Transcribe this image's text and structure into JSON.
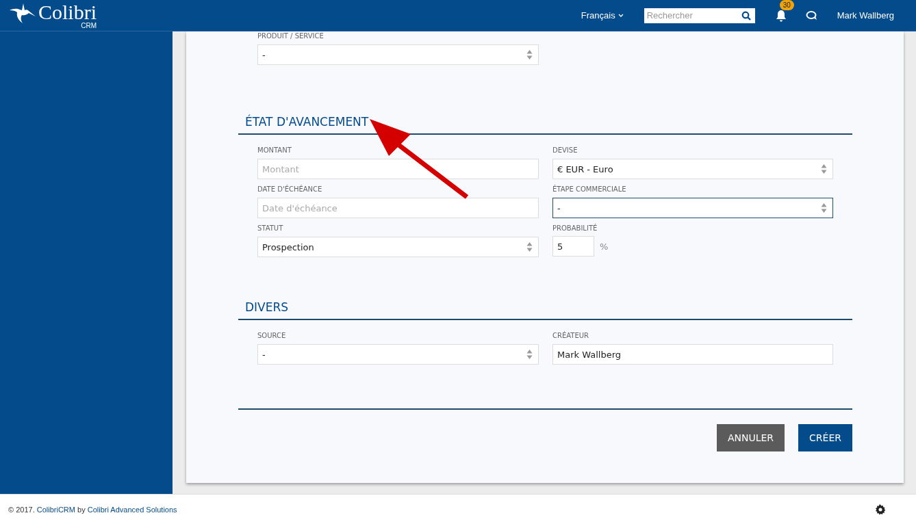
{
  "header": {
    "logo": {
      "name": "Colibri",
      "sub": "CRM"
    },
    "language": "Français",
    "search": {
      "placeholder": "Rechercher"
    },
    "notifications": {
      "count": "30"
    },
    "user": "Mark Wallberg"
  },
  "top_fields": [
    {
      "label": "PRODUIT / SERVICE",
      "kind": "select",
      "value": "-",
      "focused": false
    }
  ],
  "sections": [
    {
      "title": "ÉTAT D'AVANCEMENT",
      "fields": [
        {
          "label": "MONTANT",
          "kind": "text",
          "placeholder": "Montant",
          "focused": false
        },
        {
          "label": "DEVISE",
          "kind": "select",
          "value": "€ EUR - Euro",
          "focused": false
        },
        {
          "label": "DATE D'ÉCHÉANCE",
          "kind": "text",
          "placeholder": "Date d'échéance",
          "focused": false
        },
        {
          "label": "ÉTAPE COMMERCIALE",
          "kind": "select",
          "value": "-",
          "focused": true
        },
        {
          "label": "STATUT",
          "kind": "select",
          "value": "Prospection",
          "focused": false
        },
        {
          "label": "PROBABILITÉ",
          "kind": "percent",
          "value": "5",
          "suffix": "%",
          "focused": false
        }
      ]
    },
    {
      "title": "DIVERS",
      "fields": [
        {
          "label": "SOURCE",
          "kind": "select",
          "value": "-",
          "focused": false
        },
        {
          "label": "CRÉATEUR",
          "kind": "text",
          "value": "Mark Wallberg",
          "focused": false
        }
      ]
    }
  ],
  "buttons": [
    {
      "label": "ANNULER",
      "kind": "secondary"
    },
    {
      "label": "CRÉER",
      "kind": "primary"
    }
  ],
  "footer": {
    "parts": [
      {
        "text": "© 2017. ",
        "kind": "text"
      },
      {
        "text": "ColibriCRM",
        "kind": "link"
      },
      {
        "text": " by ",
        "kind": "text"
      },
      {
        "text": "Colibri Advanced Solutions",
        "kind": "link"
      }
    ]
  }
}
